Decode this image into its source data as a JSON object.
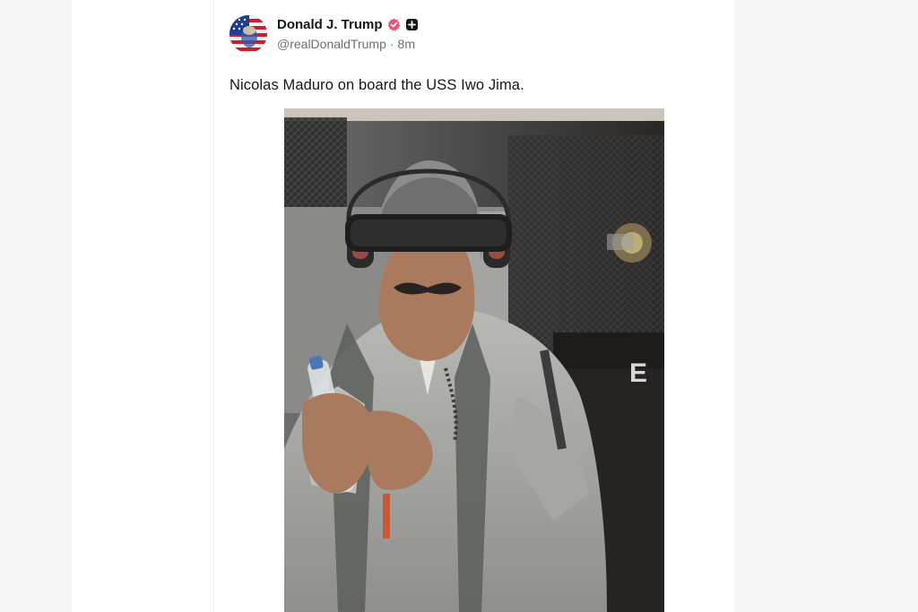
{
  "post": {
    "author": {
      "display_name": "Donald J. Trump",
      "handle": "@realDonaldTrump",
      "separator": "·",
      "time_ago": "8m",
      "verified_badge_icon": "verified-badge-icon",
      "plus_icon": "plus-square-icon",
      "badge_color": "#e4587d"
    },
    "text": "Nicolas Maduro on board the USS Iwo Jima.",
    "media": {
      "alt_kind": "photo",
      "garment_letters": "E"
    }
  }
}
